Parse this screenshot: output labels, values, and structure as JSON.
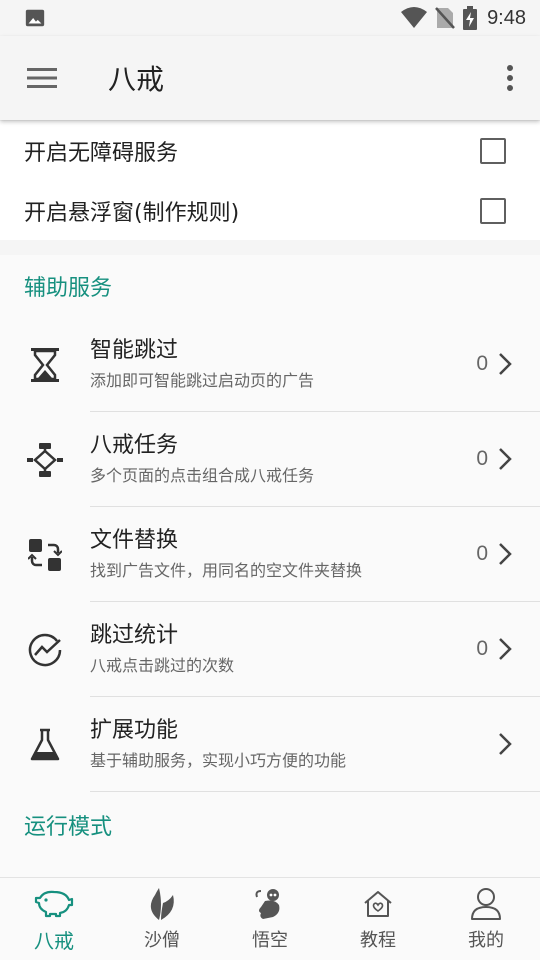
{
  "status_bar": {
    "time": "9:48"
  },
  "app_bar": {
    "title": "八戒"
  },
  "switches": [
    {
      "label": "开启无障碍服务",
      "checked": false
    },
    {
      "label": "开启悬浮窗(制作规则)",
      "checked": false
    }
  ],
  "sections": {
    "assist": "辅助服务",
    "mode": "运行模式"
  },
  "items": [
    {
      "title": "智能跳过",
      "subtitle": "添加即可智能跳过启动页的广告",
      "count": "0",
      "icon": "hourglass-icon"
    },
    {
      "title": "八戒任务",
      "subtitle": "多个页面的点击组合成八戒任务",
      "count": "0",
      "icon": "flow-icon"
    },
    {
      "title": "文件替换",
      "subtitle": "找到广告文件，用同名的空文件夹替换",
      "count": "0",
      "icon": "swap-icon"
    },
    {
      "title": "跳过统计",
      "subtitle": "八戒点击跳过的次数",
      "count": "0",
      "icon": "stats-icon"
    },
    {
      "title": "扩展功能",
      "subtitle": "基于辅助服务，实现小巧方便的功能",
      "icon": "flask-icon"
    }
  ],
  "bottom_nav": [
    {
      "label": "八戒",
      "icon": "pig-icon",
      "active": true
    },
    {
      "label": "沙僧",
      "icon": "leaf-icon",
      "active": false
    },
    {
      "label": "悟空",
      "icon": "monkey-icon",
      "active": false
    },
    {
      "label": "教程",
      "icon": "home-heart-icon",
      "active": false
    },
    {
      "label": "我的",
      "icon": "person-icon",
      "active": false
    }
  ],
  "colors": {
    "accent": "#16907f",
    "icon": "#333333"
  }
}
